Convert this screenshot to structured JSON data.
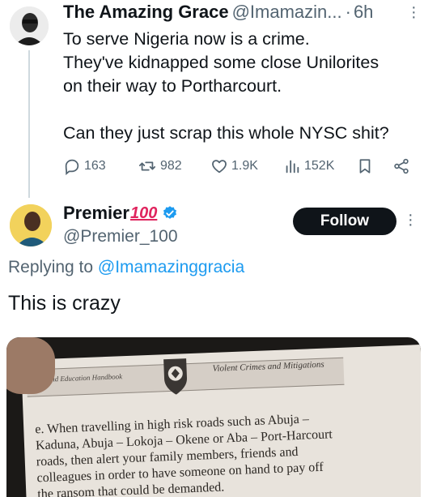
{
  "parent_tweet": {
    "author_name": "The Amazing Grace",
    "handle": "@Imamazin...",
    "separator": "·",
    "time": "6h",
    "text_lines": [
      "To serve Nigeria now is a crime.",
      "They've kidnapped some close Unilorites",
      "on their way to Portharcourt.",
      "",
      "Can they just scrap this whole NYSC shit?"
    ],
    "actions": {
      "replies": "163",
      "retweets": "982",
      "likes": "1.9K",
      "views": "152K"
    },
    "icons": [
      "more-icon",
      "reply-icon",
      "retweet-icon",
      "like-icon",
      "views-icon",
      "bookmark-icon",
      "share-icon"
    ]
  },
  "reply_tweet": {
    "author_name": "Premier",
    "name_emoji": "100",
    "handle": "@Premier_100",
    "follow_label": "Follow",
    "replying_prefix": "Replying to",
    "replying_to": "@Imamazinggracia",
    "text": "This is crazy",
    "image": {
      "header_left": "ness and Education Handbook",
      "header_right": "Violent Crimes and Mitigations",
      "lines": [
        "e.      When travelling in high risk roads such as Abuja –",
        "Kaduna, Abuja – Lokoja – Okene or Aba – Port-Harcourt",
        "roads, then alert your family members, friends and",
        "colleagues in order to have someone on hand to pay off",
        "the ransom that could be demanded."
      ]
    }
  },
  "colors": {
    "text": "#0f1419",
    "secondary": "#536471",
    "link": "#1d9bf0",
    "verified": "#1d9bf0",
    "emoji_red": "#e0245e",
    "follow_bg": "#0f1419"
  }
}
